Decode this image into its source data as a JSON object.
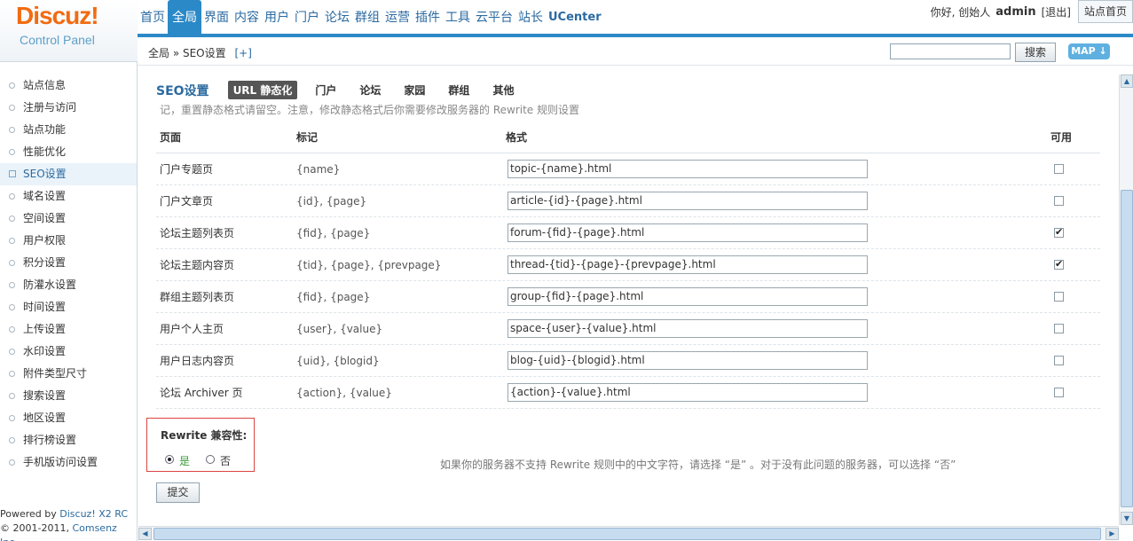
{
  "logo": {
    "brand": "Discuz!",
    "subtitle": "Control Panel"
  },
  "nav": {
    "items": [
      "首页",
      "全局",
      "界面",
      "内容",
      "用户",
      "门户",
      "论坛",
      "群组",
      "运营",
      "插件",
      "工具",
      "云平台",
      "站长",
      "UCenter"
    ],
    "active": "全局"
  },
  "user": {
    "greeting": "你好, 创始人",
    "name": "admin",
    "logout": "[退出]",
    "home": "站点首页"
  },
  "breadcrumb": {
    "text": "全局 » SEO设置",
    "plus": "[+]"
  },
  "search": {
    "value": "",
    "button": "搜索"
  },
  "map_button": "MAP ↓",
  "sidebar": {
    "items": [
      "站点信息",
      "注册与访问",
      "站点功能",
      "性能优化",
      "SEO设置",
      "域名设置",
      "空间设置",
      "用户权限",
      "积分设置",
      "防灌水设置",
      "时间设置",
      "上传设置",
      "水印设置",
      "附件类型尺寸",
      "搜索设置",
      "地区设置",
      "排行榜设置",
      "手机版访问设置"
    ],
    "active": "SEO设置"
  },
  "footer": {
    "line1_prefix": "Powered by ",
    "line1_link": "Discuz! X2 RC",
    "line2_prefix": "© 2001-2011, ",
    "line2_link": "Comsenz Inc."
  },
  "tabs": {
    "title": "SEO设置",
    "items": [
      "URL 静态化",
      "门户",
      "论坛",
      "家园",
      "群组",
      "其他"
    ],
    "active": "URL 静态化"
  },
  "description": "记，重置静态格式请留空。注意，修改静态格式后你需要修改服务器的 Rewrite 规则设置",
  "table": {
    "headers": {
      "page": "页面",
      "mark": "标记",
      "format": "格式",
      "enabled": "可用"
    },
    "rows": [
      {
        "page": "门户专题页",
        "mark": "{name}",
        "format": "topic-{name}.html",
        "enabled": false
      },
      {
        "page": "门户文章页",
        "mark": "{id}, {page}",
        "format": "article-{id}-{page}.html",
        "enabled": false
      },
      {
        "page": "论坛主题列表页",
        "mark": "{fid}, {page}",
        "format": "forum-{fid}-{page}.html",
        "enabled": true
      },
      {
        "page": "论坛主题内容页",
        "mark": "{tid}, {page}, {prevpage}",
        "format": "thread-{tid}-{page}-{prevpage}.html",
        "enabled": true
      },
      {
        "page": "群组主题列表页",
        "mark": "{fid}, {page}",
        "format": "group-{fid}-{page}.html",
        "enabled": false
      },
      {
        "page": "用户个人主页",
        "mark": "{user}, {value}",
        "format": "space-{user}-{value}.html",
        "enabled": false
      },
      {
        "page": "用户日志内容页",
        "mark": "{uid}, {blogid}",
        "format": "blog-{uid}-{blogid}.html",
        "enabled": false
      },
      {
        "page": "论坛 Archiver 页",
        "mark": "{action}, {value}",
        "format": "{action}-{value}.html",
        "enabled": false
      }
    ]
  },
  "rewrite": {
    "label": "Rewrite 兼容性:",
    "yes": "是",
    "no": "否",
    "selected": "是"
  },
  "hint": "如果你的服务器不支持 Rewrite 规则中的中文字符，请选择 “是” 。对于没有此问题的服务器，可以选择 “否”",
  "submit": "提交"
}
